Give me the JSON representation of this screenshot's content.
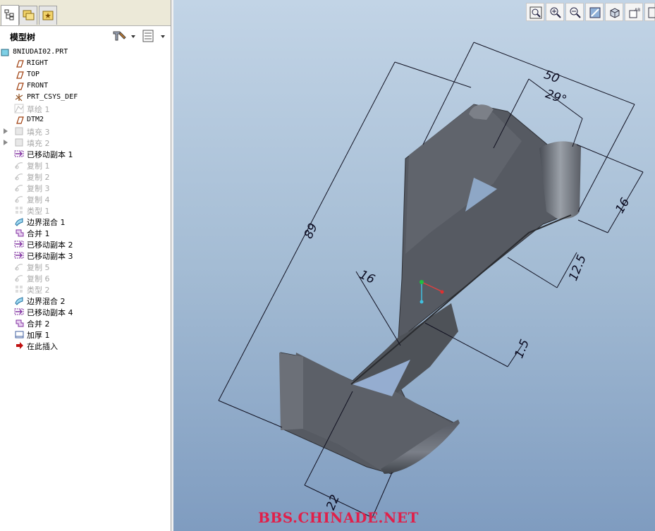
{
  "panel": {
    "title": "模型树"
  },
  "tree": {
    "items": [
      {
        "label": "8NIUDAI02.PRT",
        "icon": "part-icon",
        "state": "normal",
        "mono": true,
        "expandable": false
      },
      {
        "label": "RIGHT",
        "icon": "datum-plane-icon",
        "state": "normal",
        "mono": true,
        "expandable": false
      },
      {
        "label": "TOP",
        "icon": "datum-plane-icon",
        "state": "normal",
        "mono": true,
        "expandable": false
      },
      {
        "label": "FRONT",
        "icon": "datum-plane-icon",
        "state": "normal",
        "mono": true,
        "expandable": false
      },
      {
        "label": "PRT_CSYS_DEF",
        "icon": "coordinate-system-icon",
        "state": "normal",
        "mono": true,
        "expandable": false
      },
      {
        "label": "草绘 1",
        "icon": "sketch-icon",
        "state": "dim",
        "mono": false,
        "expandable": false
      },
      {
        "label": "DTM2",
        "icon": "datum-plane-icon",
        "state": "normal",
        "mono": true,
        "expandable": false
      },
      {
        "label": "填充 3",
        "icon": "fill-icon",
        "state": "dim",
        "mono": false,
        "expandable": true
      },
      {
        "label": "填充 2",
        "icon": "fill-icon",
        "state": "dim",
        "mono": false,
        "expandable": true
      },
      {
        "label": "已移动副本 1",
        "icon": "moved-copy-icon",
        "state": "normal",
        "mono": false,
        "expandable": false
      },
      {
        "label": "复制 1",
        "icon": "copy-icon",
        "state": "dim",
        "mono": false,
        "expandable": false
      },
      {
        "label": "复制 2",
        "icon": "copy-icon",
        "state": "dim",
        "mono": false,
        "expandable": false
      },
      {
        "label": "复制 3",
        "icon": "copy-icon",
        "state": "dim",
        "mono": false,
        "expandable": false
      },
      {
        "label": "复制 4",
        "icon": "copy-icon",
        "state": "dim",
        "mono": false,
        "expandable": false
      },
      {
        "label": "类型 1",
        "icon": "pattern-icon",
        "state": "dim",
        "mono": false,
        "expandable": false
      },
      {
        "label": "边界混合 1",
        "icon": "boundary-blend-icon",
        "state": "normal",
        "mono": false,
        "expandable": false
      },
      {
        "label": "合并 1",
        "icon": "merge-icon",
        "state": "normal",
        "mono": false,
        "expandable": false
      },
      {
        "label": "已移动副本 2",
        "icon": "moved-copy-icon",
        "state": "normal",
        "mono": false,
        "expandable": false
      },
      {
        "label": "已移动副本 3",
        "icon": "moved-copy-icon",
        "state": "normal",
        "mono": false,
        "expandable": false
      },
      {
        "label": "复制 5",
        "icon": "copy-icon",
        "state": "dim",
        "mono": false,
        "expandable": false
      },
      {
        "label": "复制 6",
        "icon": "copy-icon",
        "state": "dim",
        "mono": false,
        "expandable": false
      },
      {
        "label": "类型 2",
        "icon": "pattern-icon",
        "state": "dim",
        "mono": false,
        "expandable": false
      },
      {
        "label": "边界混合 2",
        "icon": "boundary-blend-icon",
        "state": "normal",
        "mono": false,
        "expandable": false
      },
      {
        "label": "已移动副本 4",
        "icon": "moved-copy-icon",
        "state": "normal",
        "mono": false,
        "expandable": false
      },
      {
        "label": "合并 2",
        "icon": "merge-icon",
        "state": "normal",
        "mono": false,
        "expandable": false
      },
      {
        "label": "加厚 1",
        "icon": "thicken-icon",
        "state": "normal",
        "mono": false,
        "expandable": false
      },
      {
        "label": "在此插入",
        "icon": "insert-here-arrow-icon",
        "state": "normal",
        "mono": false,
        "expandable": false
      }
    ]
  },
  "dimensions": {
    "d50": "50",
    "d29": "29°",
    "d89": "89",
    "d16a": "16",
    "d16b": "16",
    "d12_5": "12.5",
    "d1_5": "1.5",
    "d22": "22"
  },
  "watermark": "BBS.CHINADE.NET",
  "colors": {
    "part": "#5a5e66",
    "dimension": "#0a0a20",
    "watermark": "#e0204a"
  }
}
